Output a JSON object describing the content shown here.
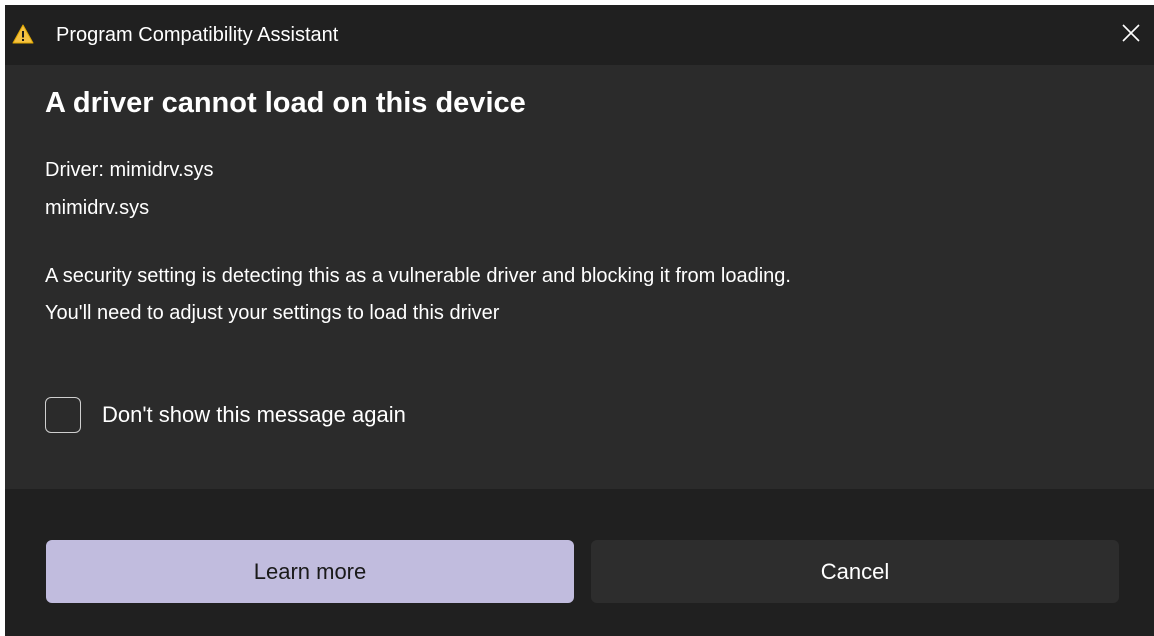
{
  "window": {
    "title": "Program Compatibility Assistant",
    "title_icon": "warning-icon",
    "close_icon": "close-icon"
  },
  "content": {
    "heading": "A driver cannot load on this device",
    "driver_label": "Driver: mimidrv.sys",
    "driver_file": "mimidrv.sys",
    "message_line1": "A security setting is detecting this as a vulnerable driver and blocking it from loading.",
    "message_line2": "You'll need to adjust your settings to load this driver",
    "checkbox_label": "Don't show this message again",
    "checkbox_checked": false
  },
  "footer": {
    "primary_label": "Learn more",
    "secondary_label": "Cancel"
  },
  "colors": {
    "titlebar": "#202020",
    "body": "#2b2b2b",
    "footer": "#202020",
    "accent_button": "#c1bcde",
    "secondary_button": "#2d2d2d",
    "warning": "#f5c242"
  }
}
